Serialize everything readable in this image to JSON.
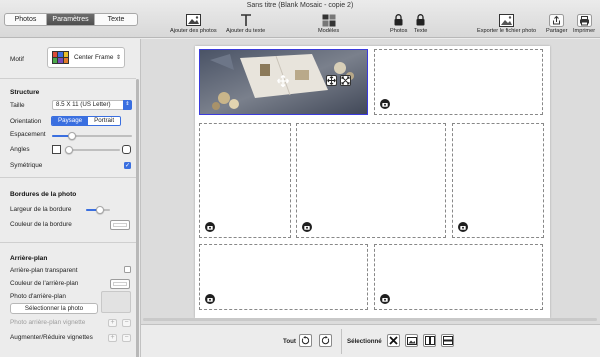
{
  "window": {
    "title": "Sans titre (Blank Mosaic - copie 2)"
  },
  "tabs": [
    {
      "label": "Photos",
      "active": false
    },
    {
      "label": "Paramètres",
      "active": true
    },
    {
      "label": "Texte",
      "active": false
    }
  ],
  "toolbar": {
    "add_photos": "Ajouter des photos",
    "add_text": "Ajouter du texte",
    "models": "Modèles",
    "lock_photos": "Photos",
    "lock_text": "Texte",
    "export": "Exporter le fichier photo",
    "share": "Partager",
    "print": "Imprimer"
  },
  "sidebar": {
    "motif_label": "Motif",
    "motif_value": "Center Frame",
    "structure": {
      "heading": "Structure",
      "size_label": "Taille",
      "size_value": "8.5 X 11 (US Letter)",
      "orientation_label": "Orientation",
      "orientation_options": [
        "Paysage",
        "Portrait"
      ],
      "orientation_selected": "Paysage",
      "spacing_label": "Espacement",
      "spacing_level": 0.25,
      "angles_label": "Angles",
      "angles_level": 0.05,
      "symmetric_label": "Symétrique",
      "symmetric_checked": true
    },
    "borders": {
      "heading": "Bordures de la photo",
      "width_label": "Largeur de la bordure",
      "width_level": 0.6,
      "color_label": "Couleur de la bordure"
    },
    "background": {
      "heading": "Arrière-plan",
      "transparent_label": "Arrière-plan transparent",
      "transparent_checked": false,
      "color_label": "Couleur de l'arrière-plan",
      "photo_label": "Photo d'arrière-plan",
      "select_photo_button": "Sélectionner la photo",
      "vignette_label": "Photo arrière-plan vignette",
      "resize_label": "Augmenter/Réduire vignettes"
    }
  },
  "bottombar": {
    "all_label": "Tout",
    "selected_label": "Sélectionné"
  },
  "colors": {
    "accent": "#3a6fe0",
    "selection_border": "#3b3bdc"
  },
  "icons": {
    "placeholder": "camera-icon",
    "move": "move-icon",
    "swap": "swap-icon",
    "fit": "fit-icon"
  }
}
